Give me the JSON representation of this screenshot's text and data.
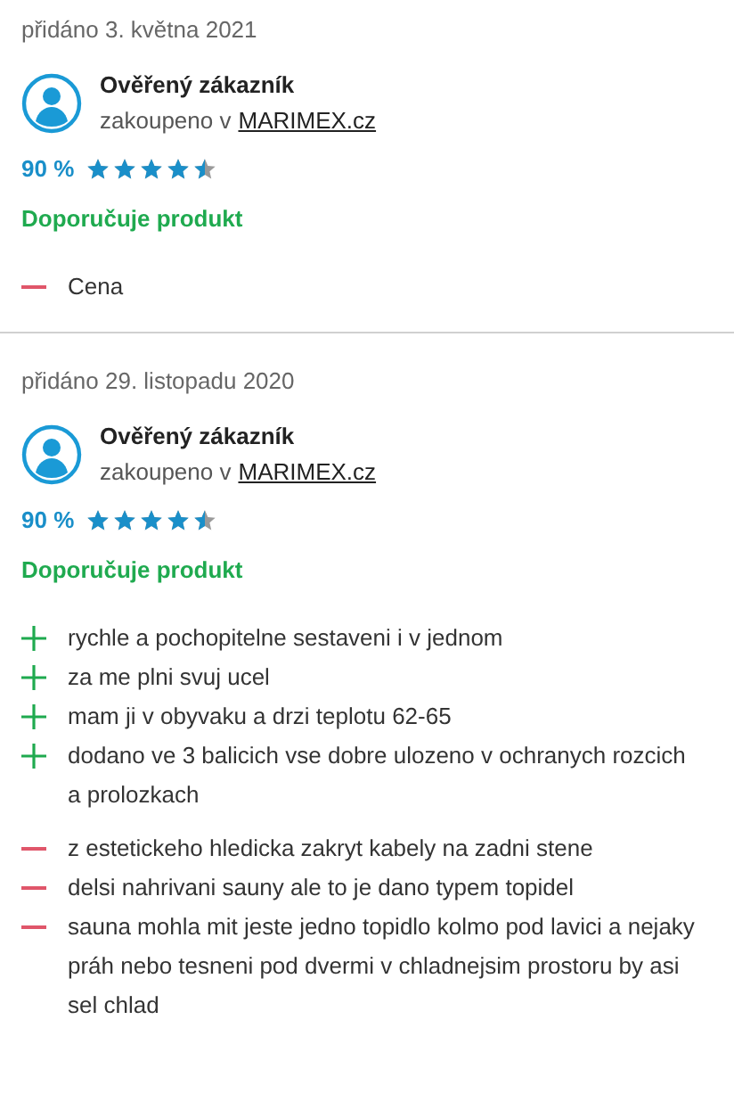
{
  "reviews": [
    {
      "date": "přidáno 3. května 2021",
      "author": "Ověřený zákazník",
      "purchased_prefix": "zakoupeno v",
      "shop_link": "MARIMEX.cz",
      "rating": "90 %",
      "stars": 4.5,
      "recommendation": "Doporučuje produkt",
      "points": [
        {
          "kind": "con",
          "text": "Cena"
        }
      ]
    },
    {
      "date": "přidáno 29. listopadu 2020",
      "author": "Ověřený zákazník",
      "purchased_prefix": "zakoupeno v",
      "shop_link": "MARIMEX.cz",
      "rating": "90 %",
      "stars": 4.5,
      "recommendation": "Doporučuje produkt",
      "points": [
        {
          "kind": "pro",
          "text": "rychle a pochopitelne sestaveni i v jednom"
        },
        {
          "kind": "pro",
          "text": "za me plni svuj ucel"
        },
        {
          "kind": "pro",
          "text": "mam ji v obyvaku a drzi teplotu 62-65"
        },
        {
          "kind": "pro",
          "text": "dodano ve 3 balicich vse dobre ulozeno v ochranych rozcich a prolozkach"
        },
        {
          "kind": "con",
          "text": "z estetickeho hledicka zakryt kabely na zadni stene"
        },
        {
          "kind": "con",
          "text": "delsi nahrivani sauny ale to je dano typem topidel"
        },
        {
          "kind": "con",
          "text": "sauna mohla mit jeste jedno topidlo kolmo pod lavici a nejaky práh nebo tesneni pod dvermi v chladnejsim prostoru by asi sel chlad"
        }
      ]
    }
  ]
}
